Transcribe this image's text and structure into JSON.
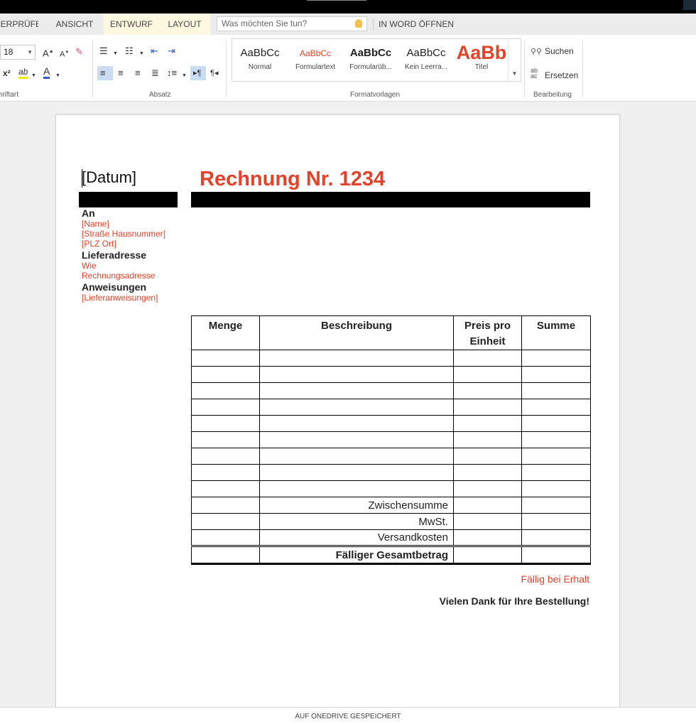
{
  "tabs": {
    "pruefen": "ÜBERPRÜFEN",
    "ansicht": "ANSICHT",
    "entwurf": "ENTWURF",
    "layout": "LAYOUT",
    "word_oeffnen": "IN WORD ÖFFNEN"
  },
  "tellme": {
    "placeholder": "Was möchten Sie tun?"
  },
  "ribbon": {
    "font_size": "18",
    "groups": {
      "schriftart": "Schriftart",
      "absatz": "Absatz",
      "formatvorlagen": "Formatvorlagen",
      "bearbeitung": "Bearbeitung"
    },
    "styles": [
      {
        "preview": "AaBbCc",
        "name": "Normal"
      },
      {
        "preview": "AaBbCc",
        "name": "Formulartext"
      },
      {
        "preview": "AaBbCc",
        "name": "Formularüb..."
      },
      {
        "preview": "AaBbCc",
        "name": "Kein Leerra..."
      },
      {
        "preview": "AaBb",
        "name": "Titel"
      }
    ],
    "edit": {
      "suchen": "Suchen",
      "ersetzen": "Ersetzen"
    }
  },
  "document": {
    "datum": "[Datum]",
    "title": "Rechnung Nr. 1234",
    "address": {
      "an_label": "An",
      "name": "[Name]",
      "strasse": "[Straße Hausnummer]",
      "plz_ort": "[PLZ Ort]",
      "liefer_label": "Lieferadresse",
      "liefer_1": "Wie",
      "liefer_2": "Rechnungsadresse",
      "anweis_label": "Anweisungen",
      "anweis": "[Lieferanweisungen]"
    },
    "table": {
      "headers": {
        "menge": "Menge",
        "beschreibung": "Beschreibung",
        "preis": "Preis pro Einheit",
        "summe": "Summe"
      },
      "zwischensumme": "Zwischensumme",
      "mwst": "MwSt.",
      "versand": "Versandkosten",
      "gesamt": "Fälliger Gesamtbetrag"
    },
    "due": "Fällig bei Erhalt",
    "thanks": "Vielen Dank für Ihre Bestellung!"
  },
  "status": {
    "saved": "AUF ONEDRIVE GESPEICHERT"
  },
  "colors": {
    "accent": "#e2432a",
    "tab_active": "#fff8e0"
  }
}
